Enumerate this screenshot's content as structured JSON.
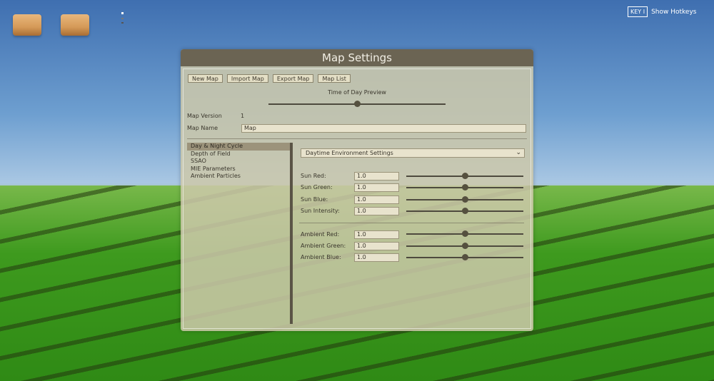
{
  "hud": {
    "key_label": "KEY",
    "hotkeys_label": "Show Hotkeys"
  },
  "window": {
    "title": "Map Settings"
  },
  "toolbar": {
    "buttons": [
      "New Map",
      "Import Map",
      "Export Map",
      "Map List"
    ]
  },
  "time_of_day": {
    "label": "Time of Day Preview",
    "value": 0.5
  },
  "map_version": {
    "label": "Map Version",
    "value": "1"
  },
  "map_name": {
    "label": "Map Name",
    "value": "Map"
  },
  "categories": {
    "selected": 0,
    "items": [
      "Day & Night Cycle",
      "Depth of Field",
      "SSAO",
      "MIE Parameters",
      "Ambient Particles"
    ]
  },
  "environment": {
    "dropdown_value": "Daytime Environment Settings",
    "sun": [
      {
        "label": "Sun Red:",
        "value": "1.0",
        "slider": 0.5
      },
      {
        "label": "Sun Green:",
        "value": "1.0",
        "slider": 0.5
      },
      {
        "label": "Sun Blue:",
        "value": "1.0",
        "slider": 0.5
      },
      {
        "label": "Sun Intensity:",
        "value": "1.0",
        "slider": 0.5
      }
    ],
    "ambient": [
      {
        "label": "Ambient Red:",
        "value": "1.0",
        "slider": 0.5
      },
      {
        "label": "Ambient Green:",
        "value": "1.0",
        "slider": 0.5
      },
      {
        "label": "Ambient Blue:",
        "value": "1.0",
        "slider": 0.5
      }
    ]
  }
}
